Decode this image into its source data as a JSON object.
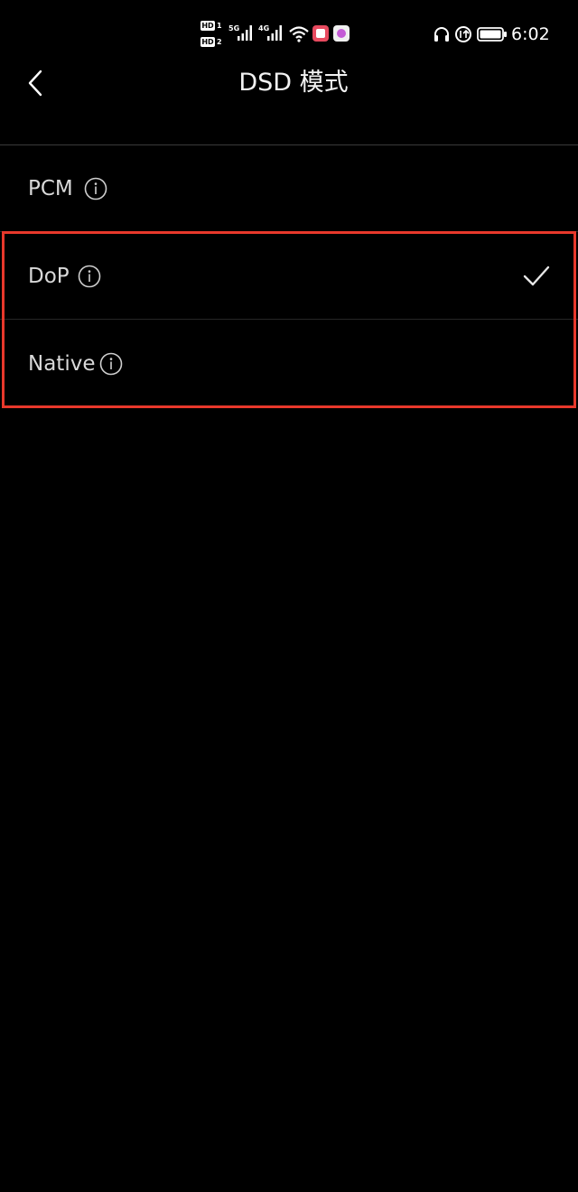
{
  "status_bar": {
    "hd1": "HD",
    "hd1_num": "1",
    "hd2": "HD",
    "hd2_num": "2",
    "net1": "5G",
    "net2": "4G",
    "time": "6:02",
    "icons": [
      "signal-icon",
      "signal-icon",
      "wifi-icon",
      "app-notification-icon",
      "app-notification-icon",
      "headphones-icon",
      "data-saver-icon",
      "battery-icon"
    ]
  },
  "header": {
    "title": "DSD 模式",
    "back_icon": "chevron-left-icon"
  },
  "options": [
    {
      "label": "PCM",
      "selected": false
    },
    {
      "label": "DoP",
      "selected": true
    },
    {
      "label": "Native",
      "selected": false
    }
  ],
  "colors": {
    "background": "#000000",
    "text": "#d9d9d9",
    "highlight_border": "#e8382b"
  }
}
